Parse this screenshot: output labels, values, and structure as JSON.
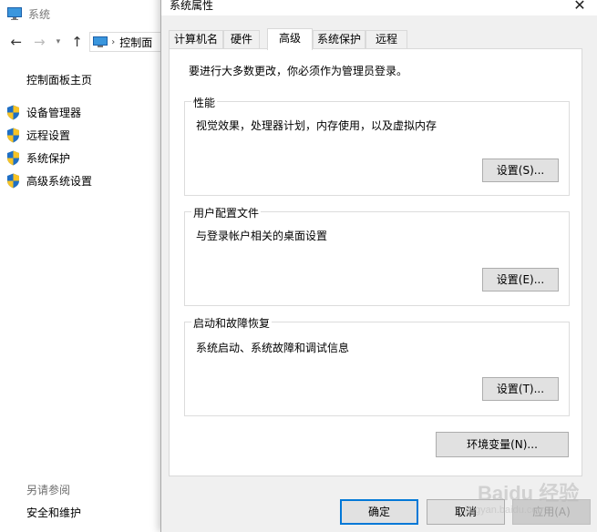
{
  "background_window": {
    "title": "系统",
    "address": {
      "segment": "控制面"
    },
    "sidebar": {
      "home": "控制面板主页",
      "links": [
        {
          "label": "设备管理器",
          "icon": "shield-icon"
        },
        {
          "label": "远程设置",
          "icon": "shield-icon"
        },
        {
          "label": "系统保护",
          "icon": "shield-icon"
        },
        {
          "label": "高级系统设置",
          "icon": "shield-icon"
        }
      ],
      "see_also": "另请参阅",
      "security_link": "安全和维护"
    }
  },
  "dialog": {
    "title": "系统属性",
    "close_icon": "close-icon",
    "tabs": [
      {
        "label": "计算机名",
        "active": false
      },
      {
        "label": "硬件",
        "active": false
      },
      {
        "label": "高级",
        "active": true
      },
      {
        "label": "系统保护",
        "active": false
      },
      {
        "label": "远程",
        "active": false
      }
    ],
    "admin_note": "要进行大多数更改，你必须作为管理员登录。",
    "groups": {
      "performance": {
        "title": "性能",
        "description": "视觉效果，处理器计划，内存使用，以及虚拟内存",
        "button": "设置(S)..."
      },
      "profiles": {
        "title": "用户配置文件",
        "description": "与登录帐户相关的桌面设置",
        "button": "设置(E)..."
      },
      "startup": {
        "title": "启动和故障恢复",
        "description": "系统启动、系统故障和调试信息",
        "button": "设置(T)..."
      }
    },
    "env_button": "环境变量(N)...",
    "buttons": {
      "ok": "确定",
      "cancel": "取消",
      "apply": "应用(A)"
    }
  },
  "watermark": {
    "brand": "Baidu 经验",
    "url": "jingyan.baidu.com"
  },
  "colors": {
    "accent": "#0078d7",
    "dialog_bg": "#f0f0f0",
    "button_bg": "#e1e1e1",
    "shield_blue": "#1f6fc4",
    "shield_yellow": "#f7c325"
  }
}
